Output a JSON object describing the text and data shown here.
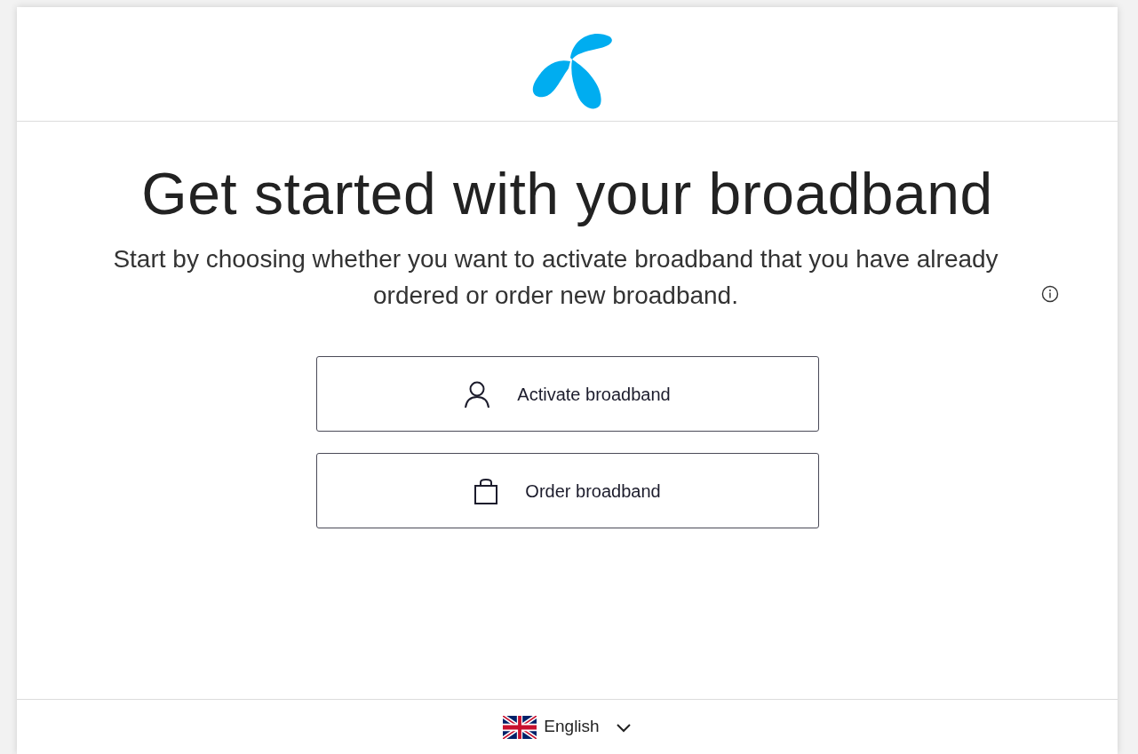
{
  "title": "Get started with your broadband",
  "subtitle": "Start by choosing whether you want to activate broadband that you have already ordered or order new broadband.",
  "buttons": [
    {
      "label": "Activate broadband",
      "kind": "person"
    },
    {
      "label": "Order broadband",
      "kind": "bag"
    }
  ],
  "language": {
    "label": "English"
  }
}
